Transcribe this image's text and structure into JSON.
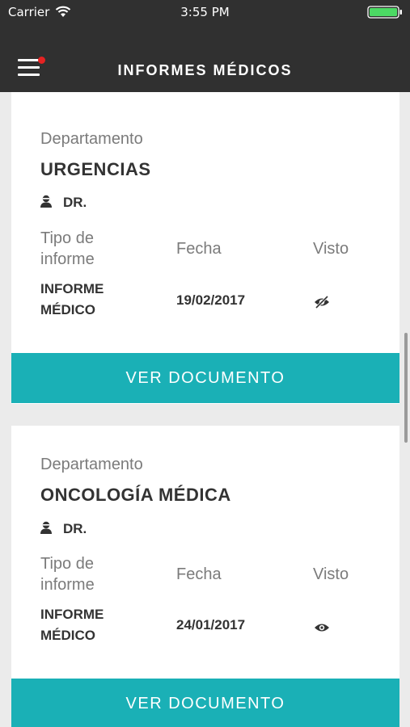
{
  "status_bar": {
    "carrier": "Carrier",
    "time": "3:55 PM",
    "battery_color": "#4cd964"
  },
  "header": {
    "title": "INFORMES MÉDICOS",
    "menu_icon": "hamburger-menu-icon",
    "notification_color": "#e52222"
  },
  "labels": {
    "department": "Departamento",
    "report_type": "Tipo de informe",
    "date": "Fecha",
    "seen": "Visto"
  },
  "reports": [
    {
      "department": "URGENCIAS",
      "doctor": "DR.",
      "report_type": "INFORME MÉDICO",
      "date": "19/02/2017",
      "seen_icon": "eye-slash-icon",
      "button": "VER DOCUMENTO"
    },
    {
      "department": "ONCOLOGÍA MÉDICA",
      "doctor": "DR.",
      "report_type": "INFORME MÉDICO",
      "date": "24/01/2017",
      "seen_icon": "eye-icon",
      "button": "VER DOCUMENTO"
    }
  ],
  "colors": {
    "header_bg": "#303030",
    "accent": "#1ab0b6",
    "background": "#ebebeb"
  }
}
